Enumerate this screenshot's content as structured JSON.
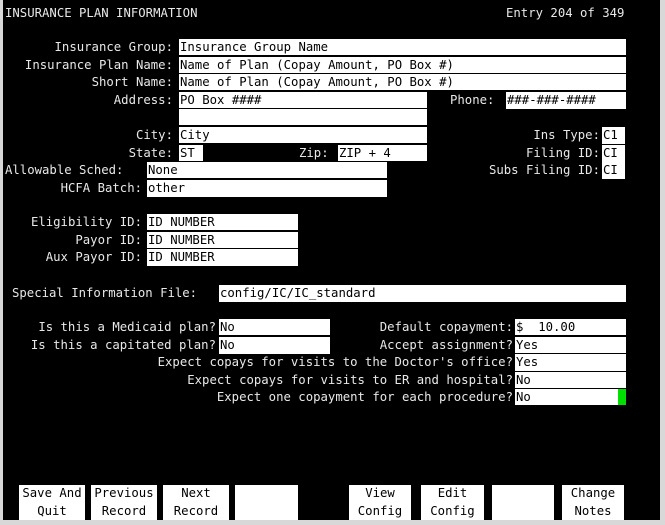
{
  "header": {
    "title": "INSURANCE PLAN INFORMATION",
    "entry_status": "Entry 204 of 349"
  },
  "form": {
    "insurance_group": {
      "label": "Insurance Group:",
      "value": "Insurance Group Name"
    },
    "insurance_plan_name": {
      "label": "Insurance Plan Name:",
      "value": "Name of Plan (Copay Amount, PO Box #)"
    },
    "short_name": {
      "label": "Short Name:",
      "value": "Name of Plan (Copay Amount, PO Box #)"
    },
    "address": {
      "label": "Address:",
      "value_line1": "PO Box ####",
      "value_line2": ""
    },
    "phone": {
      "label": "Phone:",
      "value": "###-###-####"
    },
    "city": {
      "label": "City:",
      "value": "City"
    },
    "state": {
      "label": "State:",
      "value": "ST"
    },
    "zip": {
      "label": "Zip:",
      "value": "ZIP + 4"
    },
    "ins_type": {
      "label": "Ins Type:",
      "value": "C1"
    },
    "filing_id": {
      "label": "Filing ID:",
      "value": "CI"
    },
    "subs_filing_id": {
      "label": "Subs Filing ID:",
      "value": "CI"
    },
    "allowable_sched": {
      "label": "Allowable Sched:",
      "value": "None"
    },
    "hcfa_batch": {
      "label": "HCFA Batch:",
      "value": "other"
    },
    "eligibility_id": {
      "label": "Eligibility ID:",
      "value": "ID NUMBER"
    },
    "payor_id": {
      "label": "Payor ID:",
      "value": "ID NUMBER"
    },
    "aux_payor_id": {
      "label": "Aux Payor ID:",
      "value": "ID NUMBER"
    },
    "special_info_file": {
      "label": "Special Information File:",
      "value": "config/IC/IC_standard"
    },
    "medicaid_plan": {
      "label": "Is this a Medicaid plan?",
      "value": "No"
    },
    "capitated_plan": {
      "label": "Is this a capitated plan?",
      "value": "No"
    },
    "default_copayment": {
      "label": "Default copayment:",
      "value": "$  10.00"
    },
    "accept_assignment": {
      "label": "Accept assignment?",
      "value": "Yes"
    },
    "copays_doctor": {
      "label": "Expect copays for visits to the Doctor's office?",
      "value": "Yes"
    },
    "copays_er": {
      "label": "Expect copays for visits to ER and hospital?",
      "value": "No"
    },
    "copay_each_procedure": {
      "label": "Expect one copayment for each procedure?",
      "value": "No"
    }
  },
  "cursor_color": "#00e000",
  "function_keys": [
    {
      "label": "Save And\nQuit"
    },
    {
      "label": "Previous\nRecord"
    },
    {
      "label": "Next\nRecord"
    },
    {
      "label": ""
    },
    {
      "label": "View\nConfig"
    },
    {
      "label": "Edit\nConfig"
    },
    {
      "label": ""
    },
    {
      "label": "Change\nNotes"
    }
  ]
}
